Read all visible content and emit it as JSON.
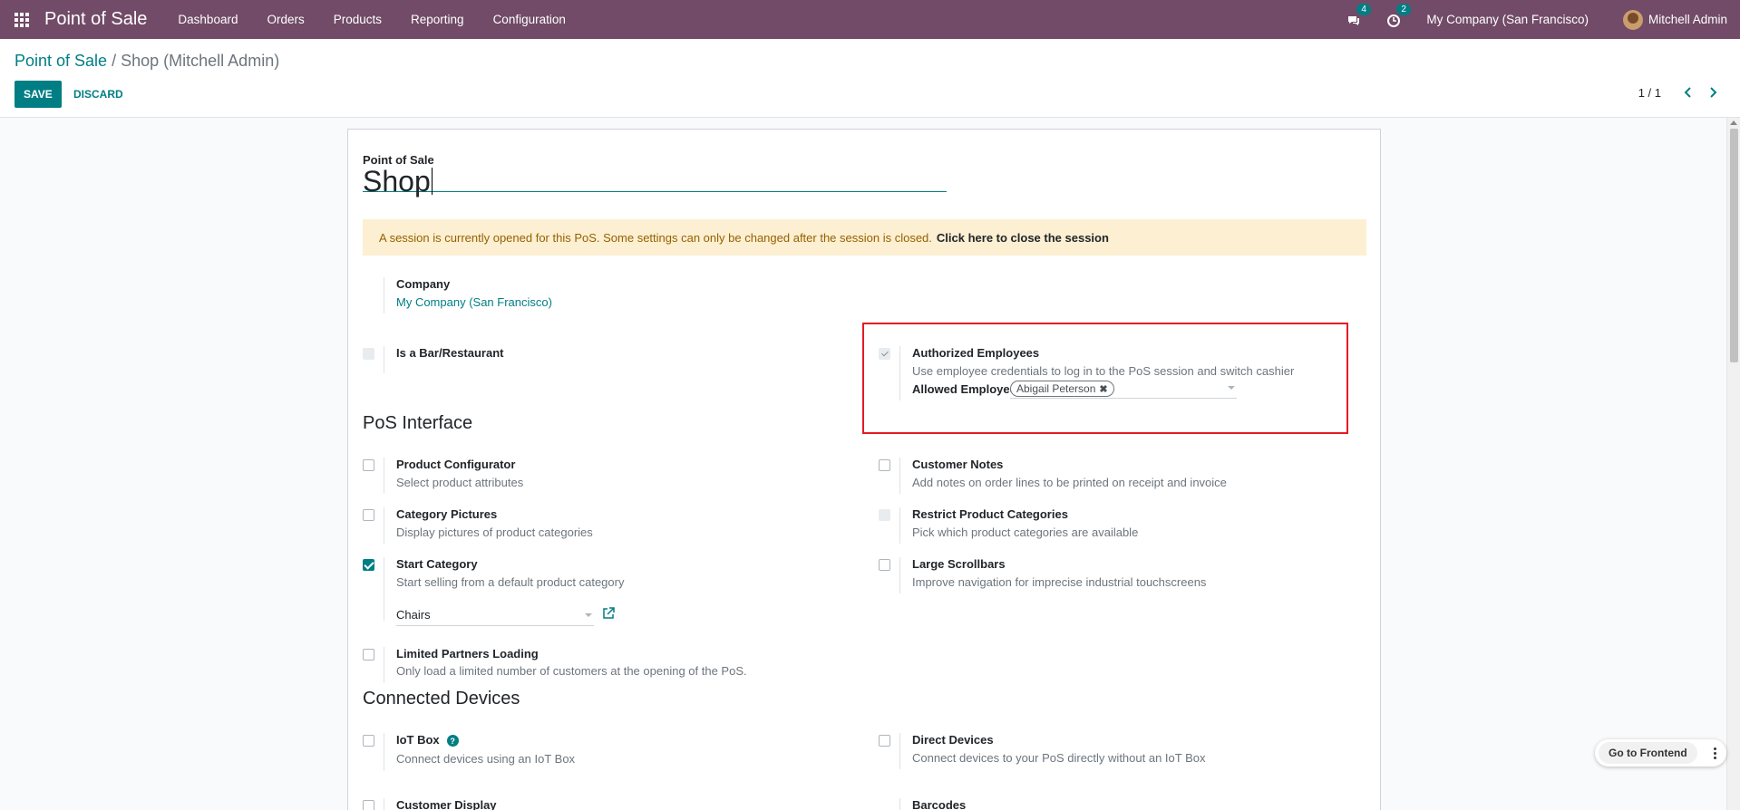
{
  "navbar": {
    "app_title": "Point of Sale",
    "menu": [
      "Dashboard",
      "Orders",
      "Products",
      "Reporting",
      "Configuration"
    ],
    "messages_count": "4",
    "activities_count": "2",
    "company": "My Company (San Francisco)",
    "user": "Mitchell Admin",
    "accent_color": "#714B67"
  },
  "control_panel": {
    "breadcrumb_root": "Point of Sale",
    "breadcrumb_separator": "/",
    "breadcrumb_current": "Shop (Mitchell Admin)",
    "save_label": "SAVE",
    "discard_label": "DISCARD",
    "pager": "1 / 1"
  },
  "form": {
    "name_label": "Point of Sale",
    "name_value": "Shop",
    "alert_text": "A session is currently opened for this PoS. Some settings can only be changed after the session is closed.",
    "alert_link": "Click here to close the session",
    "company_label": "Company",
    "company_value": "My Company (San Francisco)",
    "bar_restaurant": {
      "title": "Is a Bar/Restaurant",
      "checked": false,
      "disabled": true
    },
    "authorized_employees": {
      "title": "Authorized Employees",
      "desc": "Use employee credentials to log in to the PoS session and switch cashier",
      "allowed_label": "Allowed Employees",
      "tags": [
        "Abigail Peterson"
      ],
      "checked": true,
      "disabled": true
    },
    "pos_interface_title": "PoS Interface",
    "product_configurator": {
      "title": "Product Configurator",
      "desc": "Select product attributes",
      "checked": false
    },
    "customer_notes": {
      "title": "Customer Notes",
      "desc": "Add notes on order lines to be printed on receipt and invoice",
      "checked": false
    },
    "category_pictures": {
      "title": "Category Pictures",
      "desc": "Display pictures of product categories",
      "checked": false
    },
    "restrict_categories": {
      "title": "Restrict Product Categories",
      "desc": "Pick which product categories are available",
      "checked": false,
      "disabled": true
    },
    "start_category": {
      "title": "Start Category",
      "desc": "Start selling from a default product category",
      "checked": true,
      "value": "Chairs"
    },
    "large_scrollbars": {
      "title": "Large Scrollbars",
      "desc": "Improve navigation for imprecise industrial touchscreens",
      "checked": false
    },
    "limited_partners": {
      "title": "Limited Partners Loading",
      "desc": "Only load a limited number of customers at the opening of the PoS.",
      "checked": false
    },
    "connected_devices_title": "Connected Devices",
    "iot_box": {
      "title": "IoT Box",
      "desc": "Connect devices using an IoT Box",
      "checked": false,
      "help": "?"
    },
    "direct_devices": {
      "title": "Direct Devices",
      "desc": "Connect devices to your PoS directly without an IoT Box",
      "checked": false
    },
    "customer_display": {
      "title": "Customer Display",
      "checked": false
    },
    "barcodes": {
      "title": "Barcodes"
    }
  },
  "floating": {
    "go_to_frontend": "Go to Frontend"
  }
}
